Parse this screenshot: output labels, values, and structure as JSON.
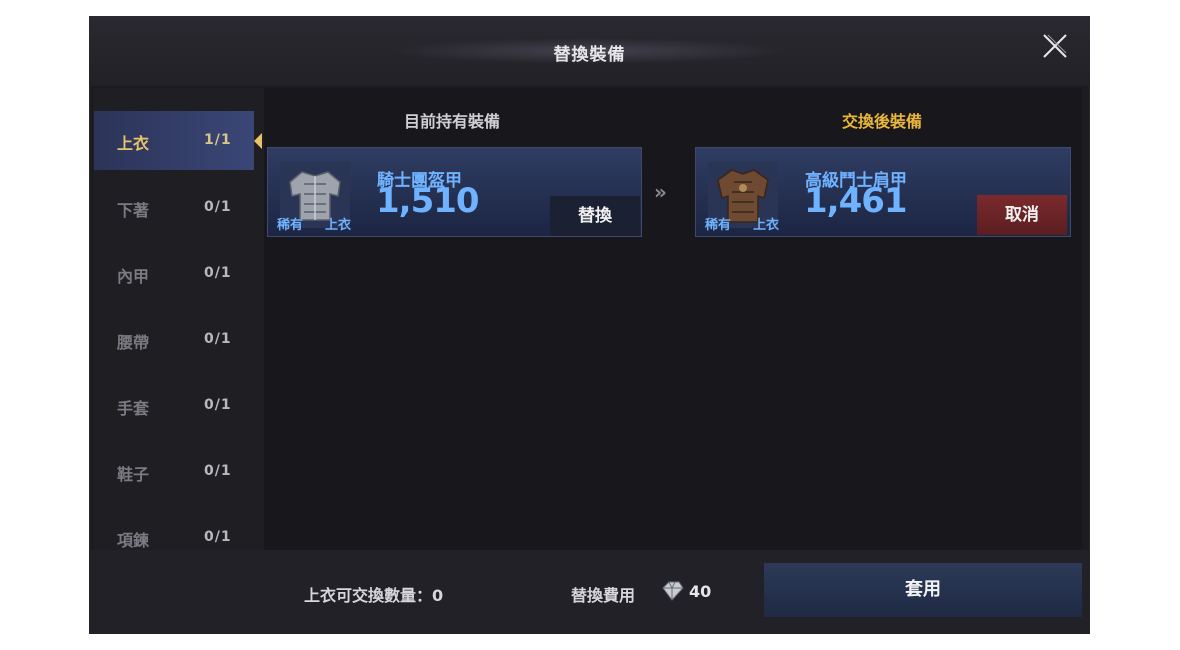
{
  "dialog": {
    "title": "替換裝備"
  },
  "sidebar": {
    "items": [
      {
        "label": "上衣",
        "count": "1/1",
        "active": true
      },
      {
        "label": "下著",
        "count": "0/1",
        "active": false
      },
      {
        "label": "內甲",
        "count": "0/1",
        "active": false
      },
      {
        "label": "腰帶",
        "count": "0/1",
        "active": false
      },
      {
        "label": "手套",
        "count": "0/1",
        "active": false
      },
      {
        "label": "鞋子",
        "count": "0/1",
        "active": false
      },
      {
        "label": "項鍊",
        "count": "0/1",
        "active": false
      }
    ]
  },
  "current": {
    "heading": "目前持有裝備",
    "item": {
      "name": "騎士團盔甲",
      "value": "1,510",
      "rarity": "稀有",
      "slot": "上衣",
      "icon": "knight-plate-armor-icon"
    },
    "swap_label": "替換"
  },
  "after": {
    "heading": "交換後裝備",
    "item": {
      "name": "高級鬥士肩甲",
      "value": "1,461",
      "rarity": "稀有",
      "slot": "上衣",
      "icon": "gladiator-armor-icon"
    },
    "cancel_label": "取消"
  },
  "arrow_glyph": "»",
  "footer": {
    "exchange_count": "上衣可交換數量：0",
    "cost_label": "替換費用",
    "cost_icon": "gem-icon",
    "cost_value": "40",
    "apply_label": "套用"
  },
  "colors": {
    "accent_gold": "#e8b53d",
    "item_blue": "#6fb2ff",
    "cancel_red": "#7a2a2c"
  }
}
